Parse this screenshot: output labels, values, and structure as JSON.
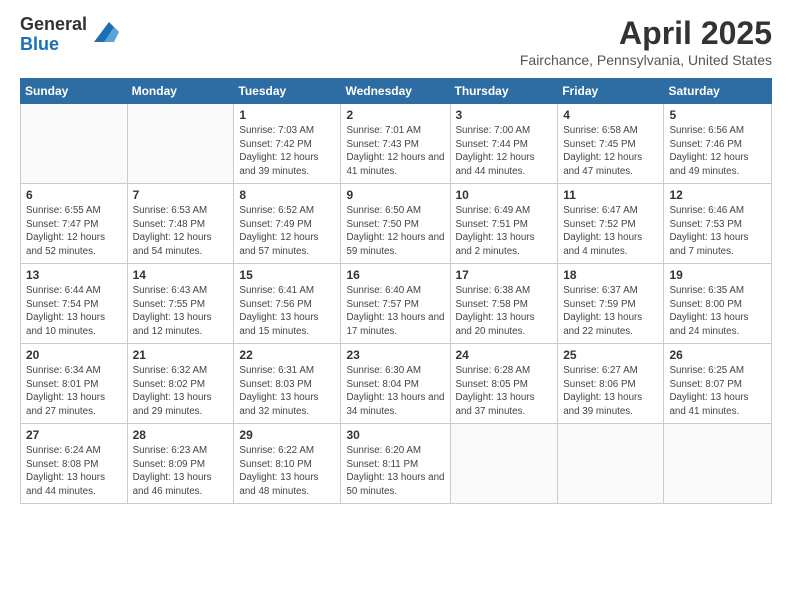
{
  "logo": {
    "general": "General",
    "blue": "Blue"
  },
  "title": "April 2025",
  "location": "Fairchance, Pennsylvania, United States",
  "days_of_week": [
    "Sunday",
    "Monday",
    "Tuesday",
    "Wednesday",
    "Thursday",
    "Friday",
    "Saturday"
  ],
  "weeks": [
    [
      {
        "day": "",
        "info": ""
      },
      {
        "day": "",
        "info": ""
      },
      {
        "day": "1",
        "info": "Sunrise: 7:03 AM\nSunset: 7:42 PM\nDaylight: 12 hours and 39 minutes."
      },
      {
        "day": "2",
        "info": "Sunrise: 7:01 AM\nSunset: 7:43 PM\nDaylight: 12 hours and 41 minutes."
      },
      {
        "day": "3",
        "info": "Sunrise: 7:00 AM\nSunset: 7:44 PM\nDaylight: 12 hours and 44 minutes."
      },
      {
        "day": "4",
        "info": "Sunrise: 6:58 AM\nSunset: 7:45 PM\nDaylight: 12 hours and 47 minutes."
      },
      {
        "day": "5",
        "info": "Sunrise: 6:56 AM\nSunset: 7:46 PM\nDaylight: 12 hours and 49 minutes."
      }
    ],
    [
      {
        "day": "6",
        "info": "Sunrise: 6:55 AM\nSunset: 7:47 PM\nDaylight: 12 hours and 52 minutes."
      },
      {
        "day": "7",
        "info": "Sunrise: 6:53 AM\nSunset: 7:48 PM\nDaylight: 12 hours and 54 minutes."
      },
      {
        "day": "8",
        "info": "Sunrise: 6:52 AM\nSunset: 7:49 PM\nDaylight: 12 hours and 57 minutes."
      },
      {
        "day": "9",
        "info": "Sunrise: 6:50 AM\nSunset: 7:50 PM\nDaylight: 12 hours and 59 minutes."
      },
      {
        "day": "10",
        "info": "Sunrise: 6:49 AM\nSunset: 7:51 PM\nDaylight: 13 hours and 2 minutes."
      },
      {
        "day": "11",
        "info": "Sunrise: 6:47 AM\nSunset: 7:52 PM\nDaylight: 13 hours and 4 minutes."
      },
      {
        "day": "12",
        "info": "Sunrise: 6:46 AM\nSunset: 7:53 PM\nDaylight: 13 hours and 7 minutes."
      }
    ],
    [
      {
        "day": "13",
        "info": "Sunrise: 6:44 AM\nSunset: 7:54 PM\nDaylight: 13 hours and 10 minutes."
      },
      {
        "day": "14",
        "info": "Sunrise: 6:43 AM\nSunset: 7:55 PM\nDaylight: 13 hours and 12 minutes."
      },
      {
        "day": "15",
        "info": "Sunrise: 6:41 AM\nSunset: 7:56 PM\nDaylight: 13 hours and 15 minutes."
      },
      {
        "day": "16",
        "info": "Sunrise: 6:40 AM\nSunset: 7:57 PM\nDaylight: 13 hours and 17 minutes."
      },
      {
        "day": "17",
        "info": "Sunrise: 6:38 AM\nSunset: 7:58 PM\nDaylight: 13 hours and 20 minutes."
      },
      {
        "day": "18",
        "info": "Sunrise: 6:37 AM\nSunset: 7:59 PM\nDaylight: 13 hours and 22 minutes."
      },
      {
        "day": "19",
        "info": "Sunrise: 6:35 AM\nSunset: 8:00 PM\nDaylight: 13 hours and 24 minutes."
      }
    ],
    [
      {
        "day": "20",
        "info": "Sunrise: 6:34 AM\nSunset: 8:01 PM\nDaylight: 13 hours and 27 minutes."
      },
      {
        "day": "21",
        "info": "Sunrise: 6:32 AM\nSunset: 8:02 PM\nDaylight: 13 hours and 29 minutes."
      },
      {
        "day": "22",
        "info": "Sunrise: 6:31 AM\nSunset: 8:03 PM\nDaylight: 13 hours and 32 minutes."
      },
      {
        "day": "23",
        "info": "Sunrise: 6:30 AM\nSunset: 8:04 PM\nDaylight: 13 hours and 34 minutes."
      },
      {
        "day": "24",
        "info": "Sunrise: 6:28 AM\nSunset: 8:05 PM\nDaylight: 13 hours and 37 minutes."
      },
      {
        "day": "25",
        "info": "Sunrise: 6:27 AM\nSunset: 8:06 PM\nDaylight: 13 hours and 39 minutes."
      },
      {
        "day": "26",
        "info": "Sunrise: 6:25 AM\nSunset: 8:07 PM\nDaylight: 13 hours and 41 minutes."
      }
    ],
    [
      {
        "day": "27",
        "info": "Sunrise: 6:24 AM\nSunset: 8:08 PM\nDaylight: 13 hours and 44 minutes."
      },
      {
        "day": "28",
        "info": "Sunrise: 6:23 AM\nSunset: 8:09 PM\nDaylight: 13 hours and 46 minutes."
      },
      {
        "day": "29",
        "info": "Sunrise: 6:22 AM\nSunset: 8:10 PM\nDaylight: 13 hours and 48 minutes."
      },
      {
        "day": "30",
        "info": "Sunrise: 6:20 AM\nSunset: 8:11 PM\nDaylight: 13 hours and 50 minutes."
      },
      {
        "day": "",
        "info": ""
      },
      {
        "day": "",
        "info": ""
      },
      {
        "day": "",
        "info": ""
      }
    ]
  ]
}
